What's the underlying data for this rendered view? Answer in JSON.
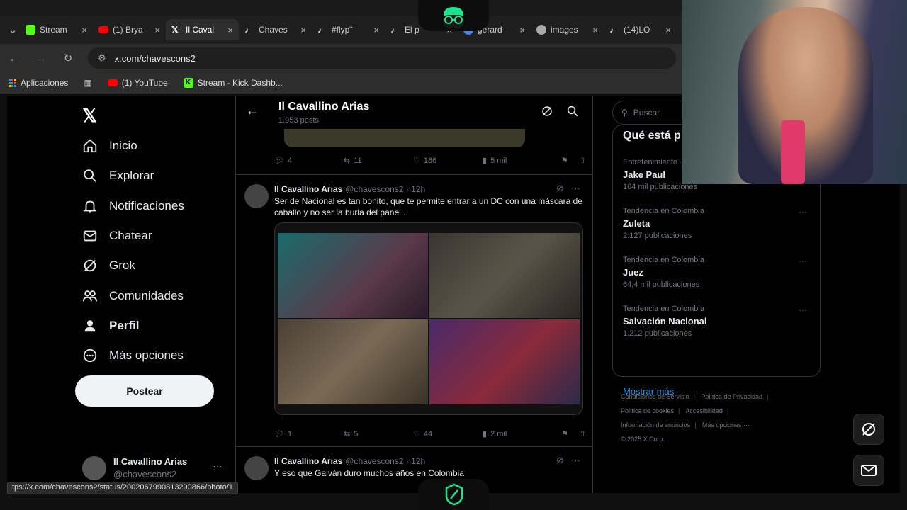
{
  "browser": {
    "tabs": [
      {
        "label": "Stream",
        "icon": "kick-icon",
        "color": "#53fc18"
      },
      {
        "label": "(1) Brya",
        "icon": "youtube-icon",
        "color": "#ff0000"
      },
      {
        "label": "Il Caval",
        "icon": "x-icon",
        "color": "#ffffff",
        "active": true
      },
      {
        "label": "Chaves",
        "icon": "tiktok-icon",
        "color": "#ffffff"
      },
      {
        "label": "#flyp¨",
        "icon": "tiktok-icon",
        "color": "#ffffff"
      },
      {
        "label": "El p",
        "icon": "tiktok-icon",
        "color": "#ffffff"
      },
      {
        "label": "gerard",
        "icon": "google-icon",
        "color": "#4285f4"
      },
      {
        "label": "images",
        "icon": "globe-icon",
        "color": "#aaaaaa"
      },
      {
        "label": "(14)LO",
        "icon": "tiktok-icon",
        "color": "#ffffff"
      }
    ],
    "url": "x.com/chavescons2",
    "bookmarks": [
      {
        "label": "Aplicaciones",
        "icon": "apps-grid-icon"
      },
      {
        "label": "(1) YouTube",
        "icon": "youtube-icon"
      },
      {
        "label": "Stream - Kick Dashb...",
        "icon": "kick-icon"
      }
    ],
    "status_url": "tps://x.com/chavescons2/status/2002067990813290866/photo/1"
  },
  "nav": {
    "items": [
      {
        "label": "Inicio",
        "icon": "home-icon"
      },
      {
        "label": "Explorar",
        "icon": "search-icon"
      },
      {
        "label": "Notificaciones",
        "icon": "bell-icon"
      },
      {
        "label": "Chatear",
        "icon": "mail-icon"
      },
      {
        "label": "Grok",
        "icon": "grok-icon"
      },
      {
        "label": "Comunidades",
        "icon": "people-icon"
      },
      {
        "label": "Perfil",
        "icon": "person-icon"
      },
      {
        "label": "Más opciones",
        "icon": "more-circle-icon"
      }
    ],
    "post_label": "Postear",
    "account": {
      "name": "Il Cavallino Arias",
      "handle": "@chavescons2"
    }
  },
  "timeline": {
    "title": "Il Cavallino Arias",
    "post_count": "1.953 posts",
    "prev_actions": {
      "replies": "4",
      "reposts": "11",
      "likes": "186",
      "views": "5 mil"
    },
    "tweets": [
      {
        "name": "Il Cavallino Arias",
        "handle": "@chavescons2 · 12h",
        "text": "Ser de Nacional es tan bonito, que te permite entrar a un DC con una máscara de caballo y no ser la burla del panel...",
        "actions": {
          "replies": "1",
          "reposts": "5",
          "likes": "44",
          "views": "2 mil"
        }
      },
      {
        "name": "Il Cavallino Arias",
        "handle": "@chavescons2 · 12h",
        "text": "Y eso que Galván duro muchos años en Colombia"
      }
    ]
  },
  "sidebar": {
    "search_placeholder": "Buscar",
    "trends_title": "Qué está p",
    "trends": [
      {
        "category": "Entretenimiento ·",
        "name": "Jake Paul",
        "count": "164 mil publicaciones"
      },
      {
        "category": "Tendencia en Colombia",
        "name": "Zuleta",
        "count": "2.127 publicaciones"
      },
      {
        "category": "Tendencia en Colombia",
        "name": "Juez",
        "count": "64,4 mil publicaciones"
      },
      {
        "category": "Tendencia en Colombia",
        "name": "Salvación Nacional",
        "count": "1.212 publicaciones"
      }
    ],
    "show_more": "Mostrar más",
    "footer": [
      "Condiciones de Servicio",
      "Política de Privacidad",
      "Política de cookies",
      "Accesibilidad",
      "Información de anuncios",
      "Más opciones ···",
      "© 2025 X Corp."
    ]
  },
  "colors": {
    "accent": "#1d9bf0",
    "brand_green": "#19e68c"
  }
}
